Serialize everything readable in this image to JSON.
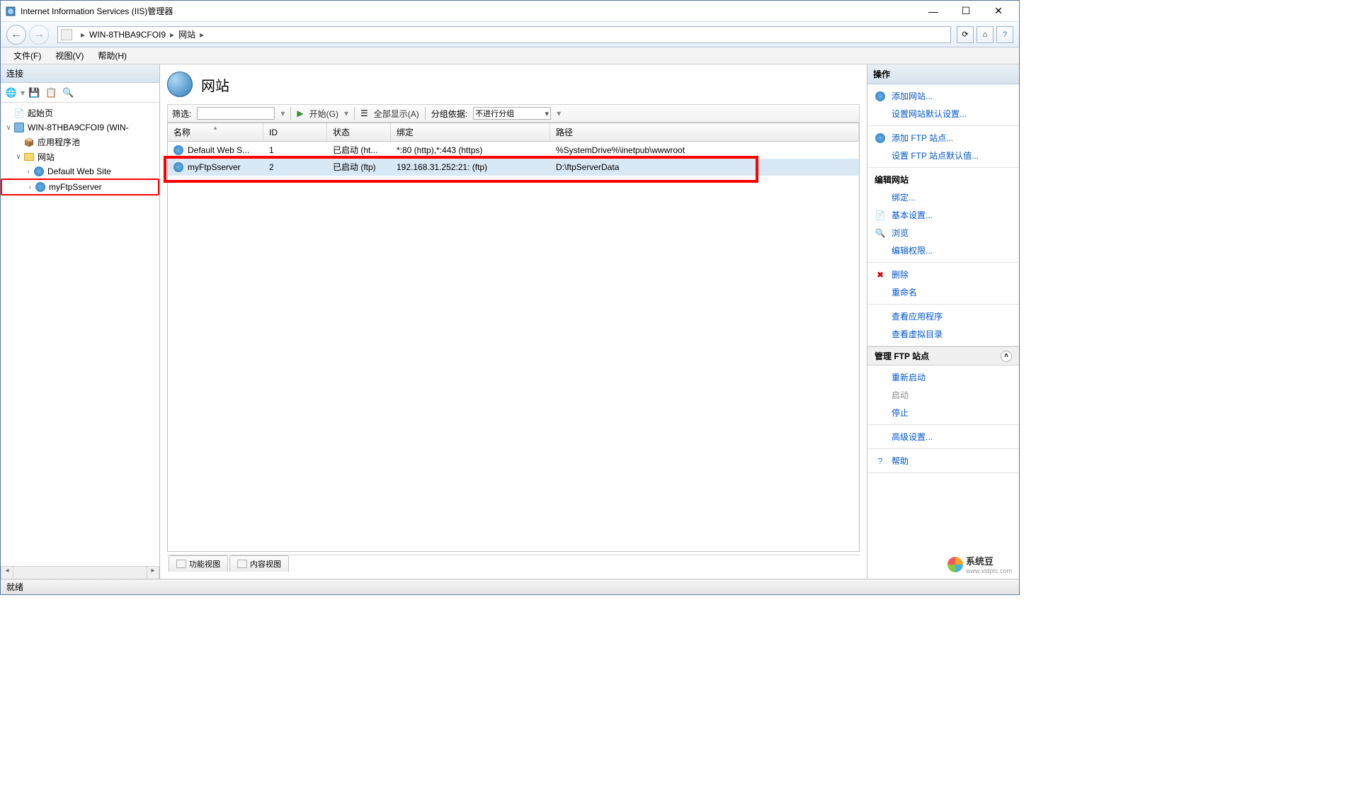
{
  "window": {
    "title": "Internet Information Services (IIS)管理器"
  },
  "breadcrumb": {
    "server": "WIN-8THBA9CFOI9",
    "section": "网站"
  },
  "menubar": {
    "file": "文件(F)",
    "view": "视图(V)",
    "help": "帮助(H)"
  },
  "sidebar": {
    "header": "连接",
    "nodes": {
      "start": "起始页",
      "server": "WIN-8THBA9CFOI9 (WIN-",
      "apppool": "应用程序池",
      "sites": "网站",
      "default_site": "Default Web Site",
      "ftp_site": "myFtpSserver"
    }
  },
  "main": {
    "title": "网站",
    "filter_label": "筛选:",
    "start_label": "开始(G)",
    "show_all": "全部显示(A)",
    "group_by_label": "分组依据:",
    "group_by_value": "不进行分组",
    "columns": {
      "name": "名称",
      "id": "ID",
      "status": "状态",
      "binding": "绑定",
      "path": "路径"
    },
    "rows": [
      {
        "name": "Default Web S...",
        "id": "1",
        "status": "已启动 (ht...",
        "binding": "*:80 (http),*:443 (https)",
        "path": "%SystemDrive%\\inetpub\\wwwroot"
      },
      {
        "name": "myFtpSserver",
        "id": "2",
        "status": "已启动 (ftp)",
        "binding": "192.168.31.252:21: (ftp)",
        "path": "D:\\ftpServerData"
      }
    ],
    "tabs": {
      "feature": "功能视图",
      "content": "内容视图"
    }
  },
  "actions": {
    "header": "操作",
    "add_site": "添加网站...",
    "site_defaults": "设置网站默认设置...",
    "add_ftp": "添加 FTP 站点...",
    "ftp_defaults": "设置 FTP 站点默认值...",
    "edit_site_header": "编辑网站",
    "bindings": "绑定...",
    "basic_settings": "基本设置...",
    "browse": "浏览",
    "edit_permissions": "编辑权限...",
    "delete": "删除",
    "rename": "重命名",
    "view_apps": "查看应用程序",
    "view_vdirs": "查看虚拟目录",
    "manage_ftp_header": "管理 FTP 站点",
    "restart": "重新启动",
    "start": "启动",
    "stop": "停止",
    "advanced": "高级设置...",
    "help": "帮助"
  },
  "statusbar": {
    "text": "就绪"
  },
  "watermark": {
    "name": "系统豆",
    "url": "www.xtdptc.com"
  }
}
